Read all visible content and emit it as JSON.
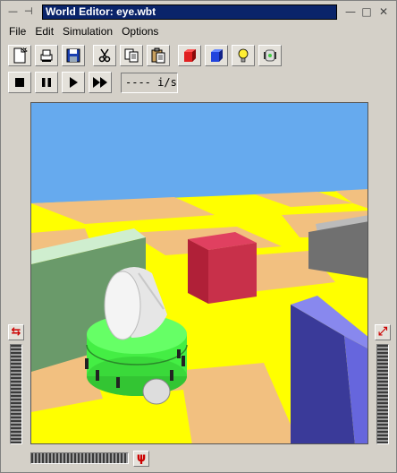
{
  "window": {
    "title": "World Editor: eye.wbt",
    "min_glyph": "—",
    "pin_glyph": "⊣",
    "minimize_glyph": "—",
    "maximize_glyph": "□",
    "close_glyph": "✕"
  },
  "menu": [
    {
      "label": "File"
    },
    {
      "label": "Edit"
    },
    {
      "label": "Simulation"
    },
    {
      "label": "Options"
    }
  ],
  "toolbar": {
    "icons": [
      "new-file-icon",
      "open-file-icon",
      "save-icon",
      "cut-icon",
      "copy-icon",
      "paste-icon",
      "red-cube-icon",
      "blue-cube-icon",
      "light-bulb-icon",
      "robot-icon"
    ],
    "playback_icons": [
      "stop-icon",
      "pause-icon",
      "play-icon",
      "fast-forward-icon"
    ],
    "speed_readout": "---- i/s"
  },
  "side": {
    "left_button_glyph": "⇆",
    "right_button_glyph": "⤢",
    "bottom_button_glyph": "ψ"
  },
  "colors": {
    "sky": "#66aaee",
    "floor_yellow": "#ffff00",
    "floor_tan": "#f2c080",
    "robot_green": "#44ee44",
    "red_box": "#cc2244",
    "blue_box": "#4444cc",
    "gray_wall": "#707070",
    "green_wall": "#6a9a6a"
  }
}
